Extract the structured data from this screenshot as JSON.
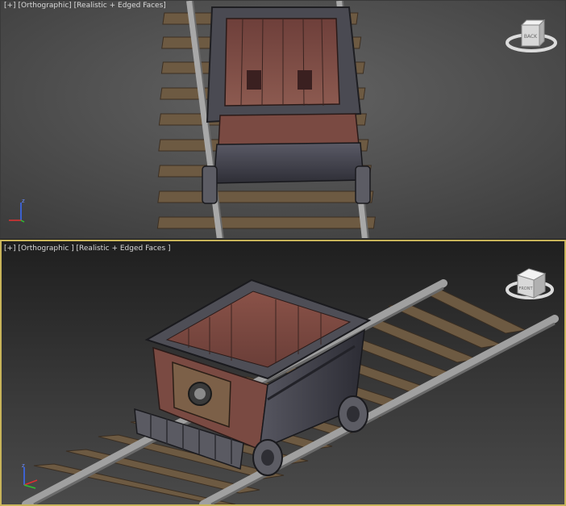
{
  "viewports": {
    "top": {
      "label_plus": "[+]",
      "label_view": "[Orthographic]",
      "label_shading": "[Realistic + Edged Faces]",
      "viewcube_face": "BACK",
      "active": false
    },
    "bottom": {
      "label_plus": "[+]",
      "label_view": "[Orthographic ]",
      "label_shading": "[Realistic + Edged Faces ]",
      "viewcube_face": "FRONT",
      "active": true
    }
  },
  "axis_labels": {
    "z": "z",
    "x": "x",
    "y": "y"
  },
  "colors": {
    "viewport_bg_top": "#5a5a5a",
    "viewport_bg_bottom": "#2e2e2e",
    "active_border": "#c8b45a",
    "cart_wood": "#7a4a42",
    "cart_metal": "#4a4a52",
    "rail": "#9a9a9a",
    "tie": "#6d5a42"
  },
  "icons": [
    "viewcube-icon",
    "axis-tripod-icon"
  ]
}
